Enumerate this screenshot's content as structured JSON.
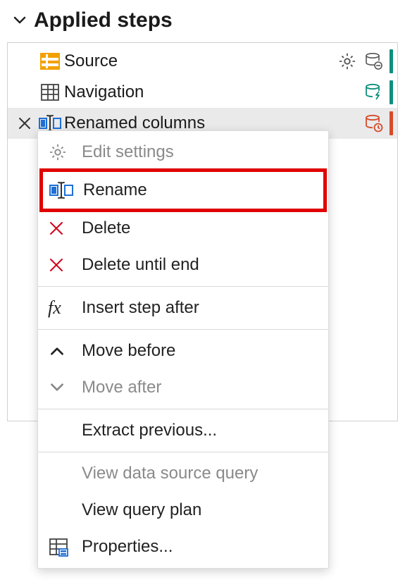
{
  "panel": {
    "title": "Applied steps"
  },
  "steps": [
    {
      "label": "Source"
    },
    {
      "label": "Navigation"
    },
    {
      "label": "Renamed columns"
    }
  ],
  "menu": {
    "edit_settings": "Edit settings",
    "rename": "Rename",
    "delete": "Delete",
    "delete_until_end": "Delete until end",
    "insert_step_after": "Insert step after",
    "move_before": "Move before",
    "move_after": "Move after",
    "extract_previous": "Extract previous...",
    "view_data_source_query": "View data source query",
    "view_query_plan": "View query plan",
    "properties": "Properties..."
  }
}
